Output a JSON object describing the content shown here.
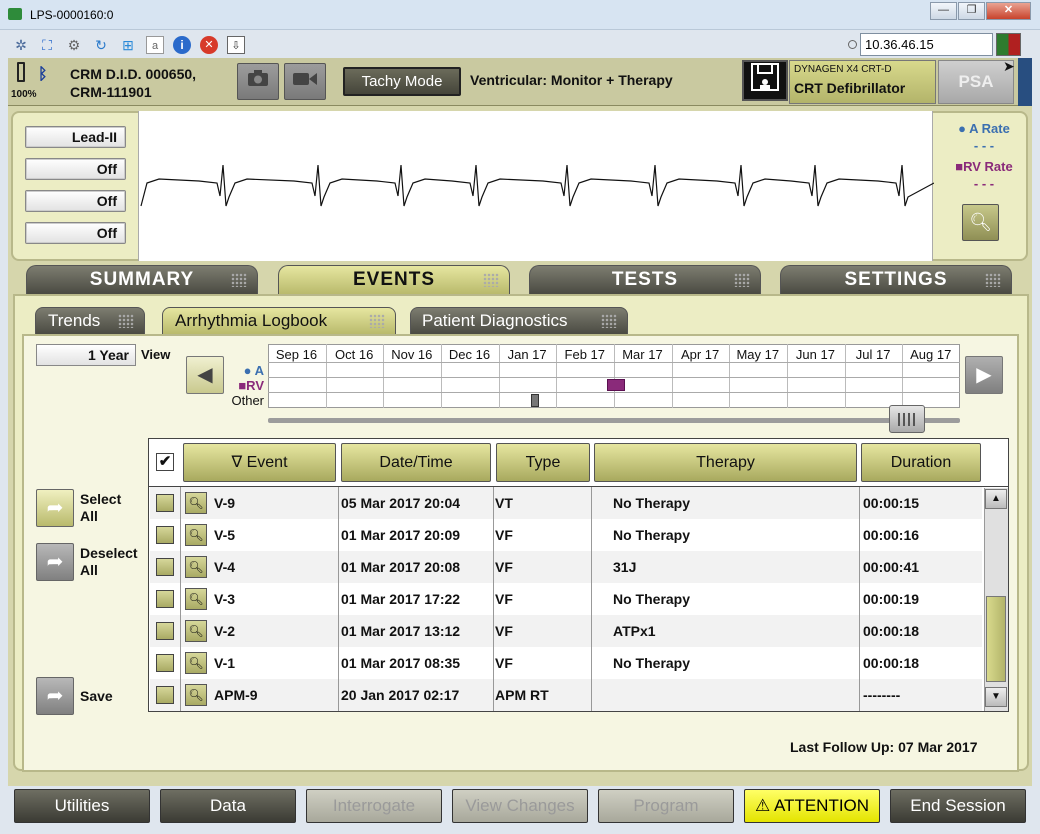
{
  "window": {
    "title": "LPS-0000160:0",
    "minimize": "—",
    "maximize": "❐",
    "close": "✕"
  },
  "toolbar": {
    "ip_address": "10.36.46.15"
  },
  "header": {
    "battery_pct": "100%",
    "device_id_line1": "CRM D.I.D. 000650,",
    "device_id_line2": "CRM-111901",
    "tachy_mode_label": "Tachy Mode",
    "ventricular_mode": "Ventricular: Monitor + Therapy",
    "device_model": "DYNAGEN X4 CRT-D",
    "device_type": "CRT Defibrillator",
    "psa_label": "PSA"
  },
  "ecg": {
    "leads": [
      "Lead-II",
      "Off",
      "Off",
      "Off"
    ],
    "a_rate_label": "A Rate",
    "a_rate_value": "- - -",
    "rv_rate_label": "RV Rate",
    "rv_rate_value": "- - -",
    "a_color": "#3b6fb0",
    "rv_color": "#8a2a7a"
  },
  "main_tabs": [
    "SUMMARY",
    "EVENTS",
    "TESTS",
    "SETTINGS"
  ],
  "sub_tabs": [
    "Trends",
    "Arrhythmia Logbook",
    "Patient Diagnostics"
  ],
  "timeline": {
    "span_label": "1 Year",
    "view_label": "View",
    "months": [
      "Sep 16",
      "Oct 16",
      "Nov 16",
      "Dec 16",
      "Jan 17",
      "Feb 17",
      "Mar 17",
      "Apr 17",
      "May 17",
      "Jun 17",
      "Jul 17",
      "Aug 17"
    ],
    "row_labels": [
      "A",
      "RV",
      "Other"
    ]
  },
  "side": {
    "select_all": "Select All",
    "deselect_all": "Deselect All",
    "save": "Save"
  },
  "table": {
    "headers": {
      "event": "Event",
      "datetime": "Date/Time",
      "type": "Type",
      "therapy": "Therapy",
      "duration": "Duration"
    },
    "rows": [
      {
        "event": "V-9",
        "datetime": "05 Mar 2017 20:04",
        "type": "VT",
        "therapy": "No Therapy",
        "duration": "00:00:15"
      },
      {
        "event": "V-5",
        "datetime": "01 Mar 2017 20:09",
        "type": "VF",
        "therapy": "No Therapy",
        "duration": "00:00:16"
      },
      {
        "event": "V-4",
        "datetime": "01 Mar 2017 20:08",
        "type": "VF",
        "therapy": "31J",
        "duration": "00:00:41"
      },
      {
        "event": "V-3",
        "datetime": "01 Mar 2017 17:22",
        "type": "VF",
        "therapy": "No Therapy",
        "duration": "00:00:19"
      },
      {
        "event": "V-2",
        "datetime": "01 Mar 2017 13:12",
        "type": "VF",
        "therapy": "ATPx1",
        "duration": "00:00:18"
      },
      {
        "event": "V-1",
        "datetime": "01 Mar 2017 08:35",
        "type": "VF",
        "therapy": "No Therapy",
        "duration": "00:00:18"
      },
      {
        "event": "APM-9",
        "datetime": "20 Jan 2017 02:17",
        "type": "APM RT",
        "therapy": "",
        "duration": "--------"
      }
    ]
  },
  "last_follow_up": {
    "label": "Last Follow Up:",
    "value": "07 Mar 2017"
  },
  "bottom": {
    "utilities": "Utilities",
    "data": "Data",
    "interrogate": "Interrogate",
    "view_changes": "View Changes",
    "program": "Program",
    "attention": "ATTENTION",
    "end_session": "End Session"
  }
}
